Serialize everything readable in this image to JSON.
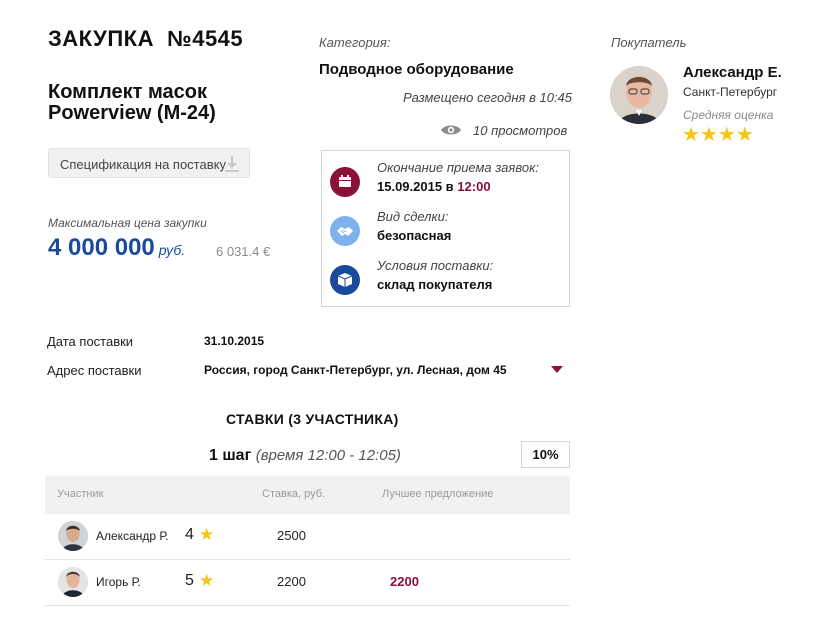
{
  "header": {
    "title": "ЗАКУПКА  №4545"
  },
  "product": {
    "name": "Комплект масок Powerview (M-24)"
  },
  "spec": {
    "label": "Спецификация на поставку"
  },
  "max_price": {
    "label": "Максимальная цена закупки",
    "value": "4 000 000",
    "currency": "руб.",
    "eur": "6 031.4 €"
  },
  "category": {
    "label": "Категория:",
    "value": "Подводное оборудование"
  },
  "placed": "Размещено сегодня в 10:45",
  "views": "10 просмотров",
  "info": {
    "deadline_label": "Окончание приема заявок:",
    "deadline_date": "15.09.2015 в",
    "deadline_time": "12:00",
    "deal_label": "Вид сделки:",
    "deal_value": "безопасная",
    "terms_label": "Условия поставки:",
    "terms_value": "склад покупателя"
  },
  "buyer": {
    "label": "Покупатель",
    "name": "Александр Е.",
    "city": "Санкт-Петербург",
    "rating_label": "Средняя оценка",
    "rating": 4
  },
  "delivery": {
    "date_label": "Дата поставки",
    "date_value": "31.10.2015",
    "address_label": "Адрес поставки",
    "address_value": "Россия, город Санкт-Петербург, ул. Лесная, дом 45"
  },
  "bids": {
    "title": "СТАВКИ (3 УЧАСТНИКА)",
    "step": "1 шаг",
    "step_time": "(время 12:00 - 12:05)",
    "percent": "10%",
    "columns": {
      "participant": "Участник",
      "bid": "Ставка, руб.",
      "best": "Лучшее предложение"
    },
    "rows": [
      {
        "name": "Александр Р.",
        "rating": "4",
        "bid": "2500",
        "best": ""
      },
      {
        "name": "Игорь Р.",
        "rating": "5",
        "bid": "2200",
        "best": "2200"
      }
    ]
  },
  "colors": {
    "accent": "#8b1136",
    "price": "#1a4a9a",
    "star": "#f5c518"
  }
}
